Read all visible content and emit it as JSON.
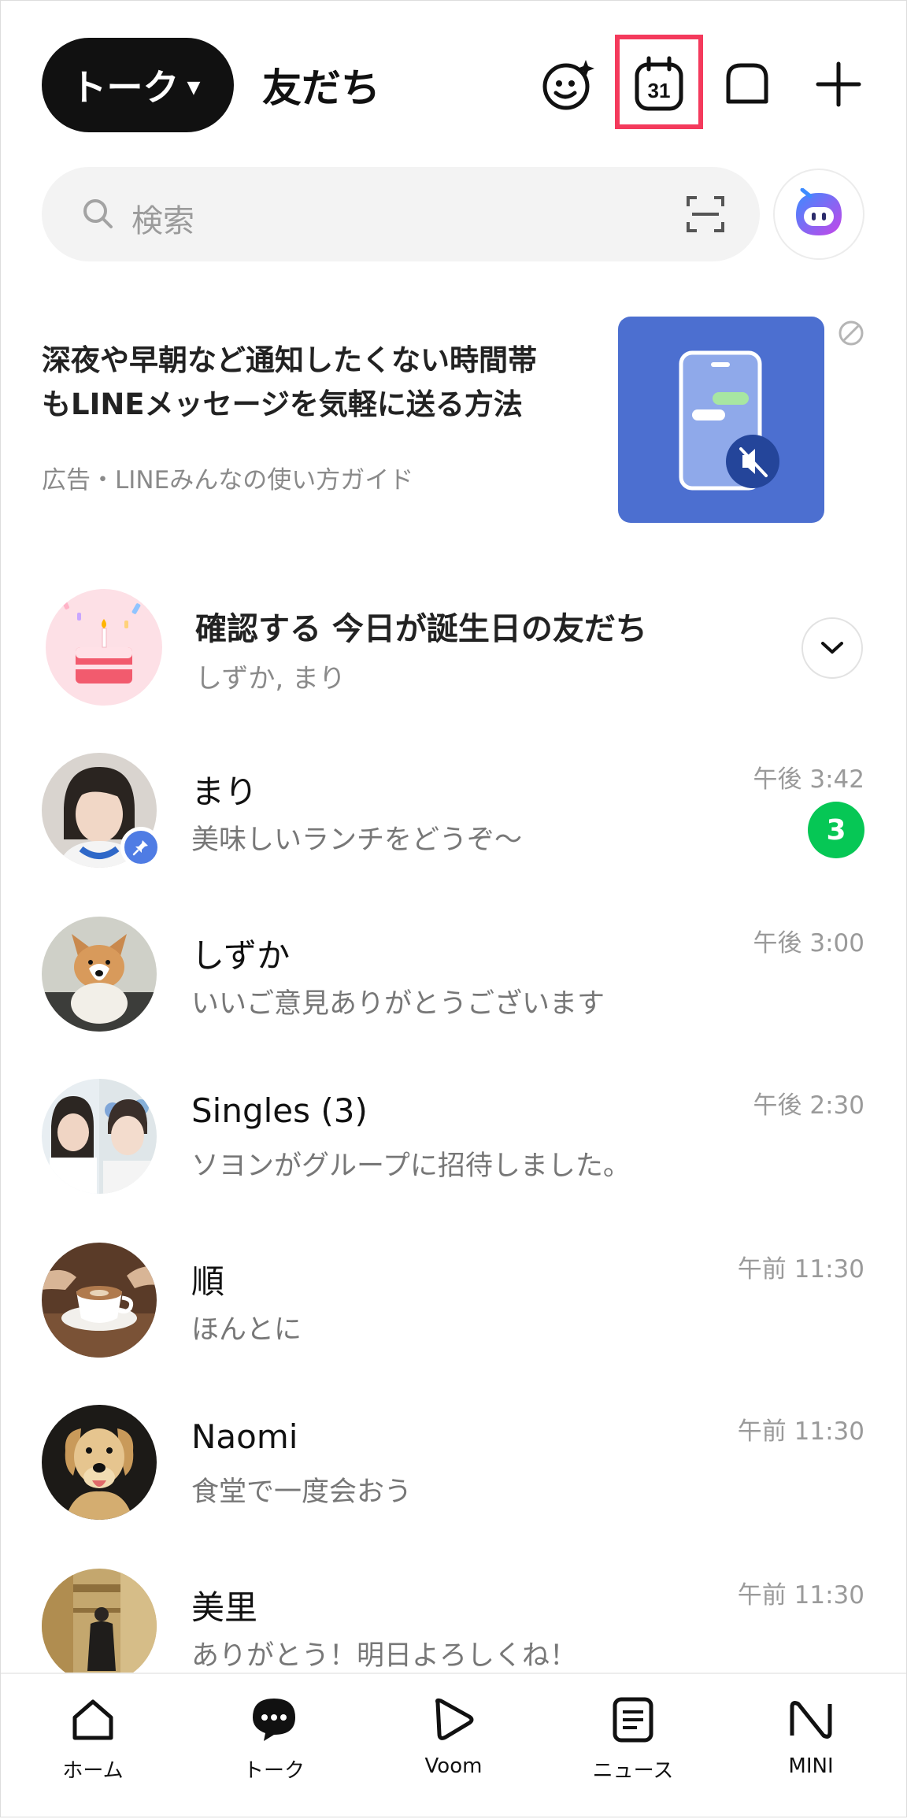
{
  "header": {
    "talk_tab": "トーク",
    "friends_tab": "友だち",
    "calendar_day": "31"
  },
  "search": {
    "placeholder": "検索"
  },
  "ad": {
    "title_line1": "深夜や早朝など通知したくない時間帯",
    "title_line2": "もLINEメッセージを気軽に送る方法",
    "sponsor": "広告・LINEみんなの使い方ガイド"
  },
  "birthday": {
    "title": "確認する 今日が誕生日の友だち",
    "names": "しずか, まり"
  },
  "chats": [
    {
      "name": "まり",
      "message": "美味しいランチをどうぞ〜",
      "time": "午後 3:42",
      "unread": "3",
      "pinned": true
    },
    {
      "name": "しずか",
      "message": "いいご意見ありがとうございます",
      "time": "午後 3:00"
    },
    {
      "name": "Singles (3)",
      "message": "ソヨンがグループに招待しました。",
      "time": "午後 2:30"
    },
    {
      "name": "順",
      "message": "ほんとに",
      "time": "午前 11:30"
    },
    {
      "name": "Naomi",
      "message": "食堂で一度会おう",
      "time": "午前 11:30"
    },
    {
      "name": "美里",
      "message": "ありがとう！明日よろしくね！",
      "time": "午前 11:30"
    }
  ],
  "nav": [
    {
      "label": "ホーム",
      "icon": "home-icon"
    },
    {
      "label": "トーク",
      "icon": "chat-bubble-icon"
    },
    {
      "label": "Voom",
      "icon": "voom-icon"
    },
    {
      "label": "ニュース",
      "icon": "news-icon"
    },
    {
      "label": "MINI",
      "icon": "mini-icon"
    }
  ],
  "colors": {
    "accent_green": "#06c755",
    "highlight": "#f43a5c",
    "ad_bg": "#4c6fd0",
    "pin_blue": "#4f7ce4"
  }
}
